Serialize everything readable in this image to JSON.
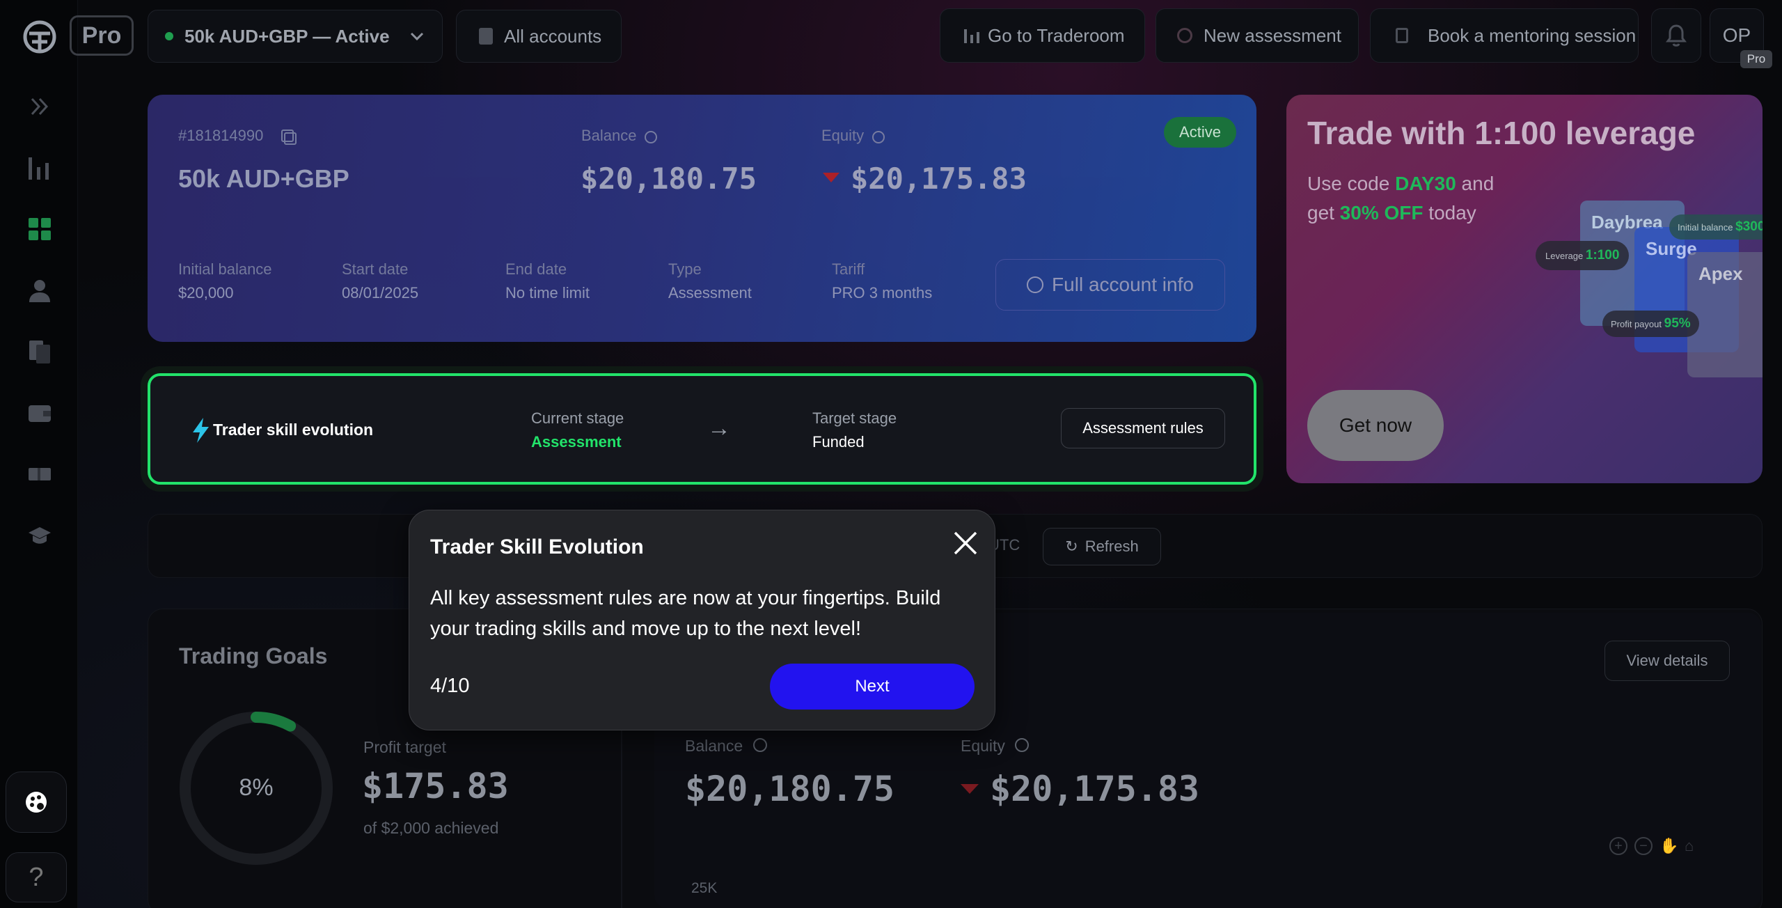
{
  "brand": {
    "badge": "Pro"
  },
  "topbar": {
    "account_selector": "50k AUD+GBP — Active",
    "all_accounts": "All accounts",
    "traderoom": "Go to Traderoom",
    "new_assessment": "New assessment",
    "mentoring": "Book a mentoring session",
    "avatar_initials": "OP",
    "avatar_badge": "Pro"
  },
  "account_card": {
    "id": "#181814990",
    "name": "50k AUD+GBP",
    "status": "Active",
    "balance_label": "Balance",
    "balance": "$20,180.75",
    "equity_label": "Equity",
    "equity": "$20,175.83",
    "initial_balance_label": "Initial balance",
    "initial_balance": "$20,000",
    "start_date_label": "Start date",
    "start_date": "08/01/2025",
    "end_date_label": "End date",
    "end_date": "No time limit",
    "type_label": "Type",
    "type": "Assessment",
    "tariff_label": "Tariff",
    "tariff": "PRO 3 months",
    "full_info": "Full account info"
  },
  "promo": {
    "title": "Trade with 1:100 leverage",
    "line1_a": "Use code ",
    "code": "DAY30",
    "line1_b": " and",
    "line2_a": "get ",
    "discount": "30% OFF",
    "line2_b": " today",
    "cta": "Get now",
    "card1": "Daybrea",
    "card2": "Surge",
    "card3": "Apex",
    "chip1_label": "Initial balance",
    "chip1_value": "$300",
    "chip2_label": "Leverage",
    "chip2_value": "1:100",
    "chip3_label": "Profit payout",
    "chip3_value": "95%"
  },
  "skill": {
    "title": "Trader skill evolution",
    "current_label": "Current stage",
    "current": "Assessment",
    "arrow": "→",
    "target_label": "Target stage",
    "target": "Funded",
    "rules": "Assessment rules"
  },
  "toolbar": {
    "utc": "UTC",
    "refresh": "Refresh"
  },
  "goals": {
    "title": "Trading Goals",
    "progress": 8,
    "progress_text": "8%",
    "profit_label": "Profit target",
    "profit": "$175.83",
    "achieved": "of $2,000 achieved"
  },
  "chart_panel": {
    "view_details": "View details",
    "balance_label": "Balance",
    "balance": "$20,180.75",
    "equity_label": "Equity",
    "equity": "$20,175.83",
    "y_tick": "25K"
  },
  "modal": {
    "title": "Trader Skill Evolution",
    "body": "All key assessment rules are now at your fingertips. Build your trading skills and move up to the next level!",
    "step": "4/10",
    "next": "Next"
  },
  "colors": {
    "accent_green": "#22e36a",
    "next_button": "#2213ef",
    "down_red": "#b8222a"
  }
}
